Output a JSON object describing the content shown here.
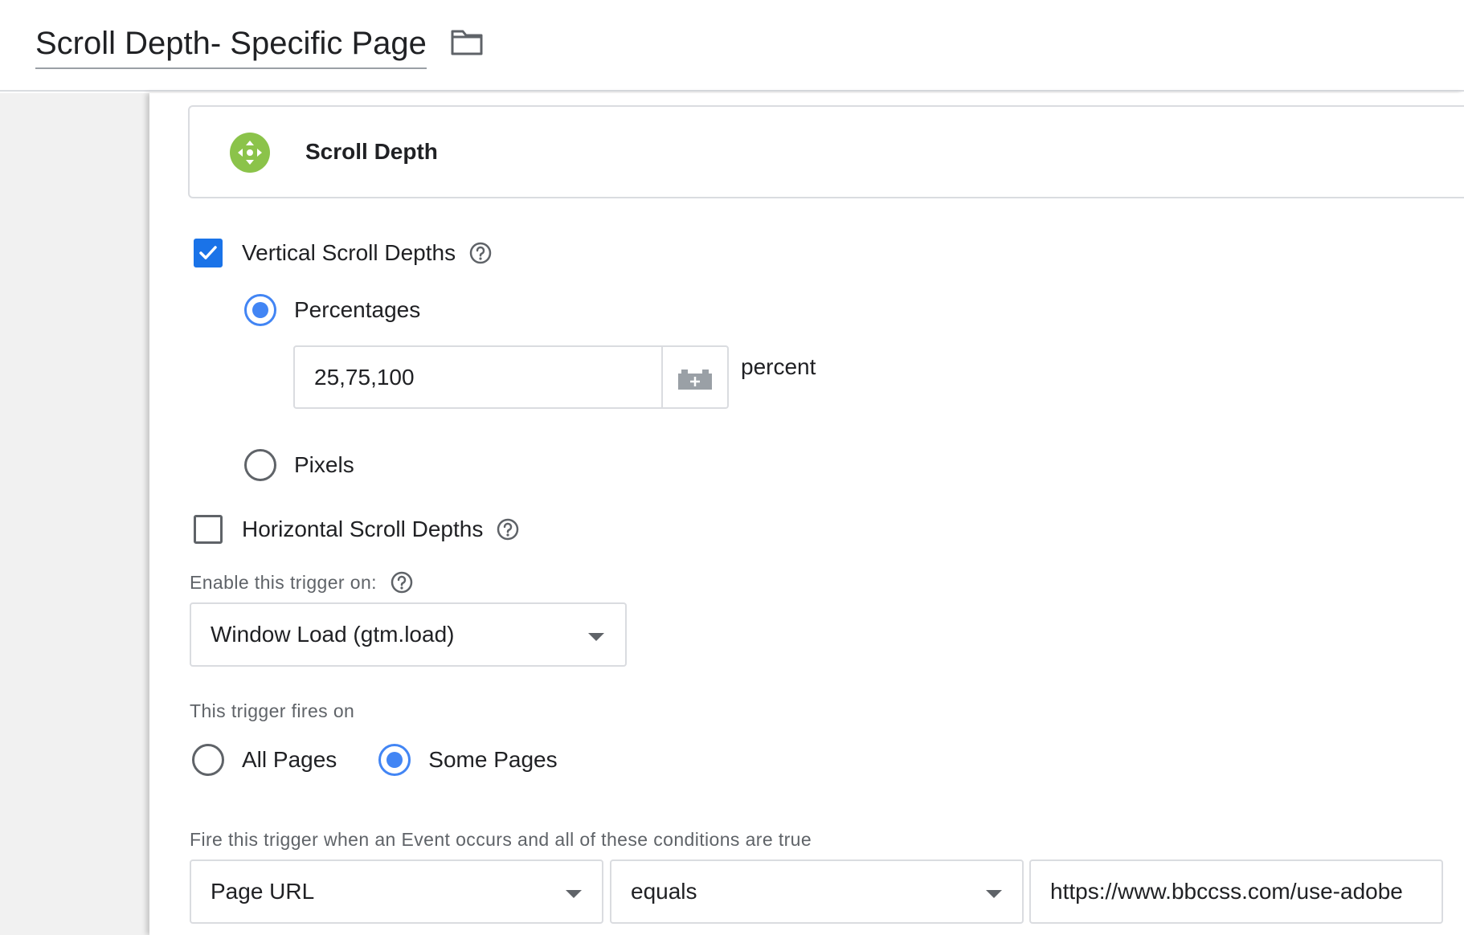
{
  "header": {
    "title": "Scroll Depth- Specific Page",
    "folder_icon": "folder-icon"
  },
  "trigger_type": {
    "name": "Scroll Depth",
    "icon": "scroll-depth-icon",
    "icon_color": "#8bc34a"
  },
  "vertical": {
    "label": "Vertical Scroll Depths",
    "checked": true,
    "options": {
      "percentages_label": "Percentages",
      "percentages_checked": true,
      "percentages_value": "25,75,100",
      "percentages_unit": "percent",
      "pixels_label": "Pixels",
      "pixels_checked": false
    }
  },
  "horizontal": {
    "label": "Horizontal Scroll Depths",
    "checked": false
  },
  "enable_on": {
    "label": "Enable this trigger on:",
    "selected": "Window Load (gtm.load)"
  },
  "fires_on": {
    "label": "This trigger fires on",
    "all_pages_label": "All Pages",
    "some_pages_label": "Some Pages",
    "selected": "Some Pages"
  },
  "conditions": {
    "label": "Fire this trigger when an Event occurs and all of these conditions are true",
    "variable": "Page URL",
    "operator": "equals",
    "value": "https://www.bbccss.com/use-adobe"
  },
  "colors": {
    "accent_blue": "#1a73e8",
    "radio_blue": "#4285f4"
  }
}
